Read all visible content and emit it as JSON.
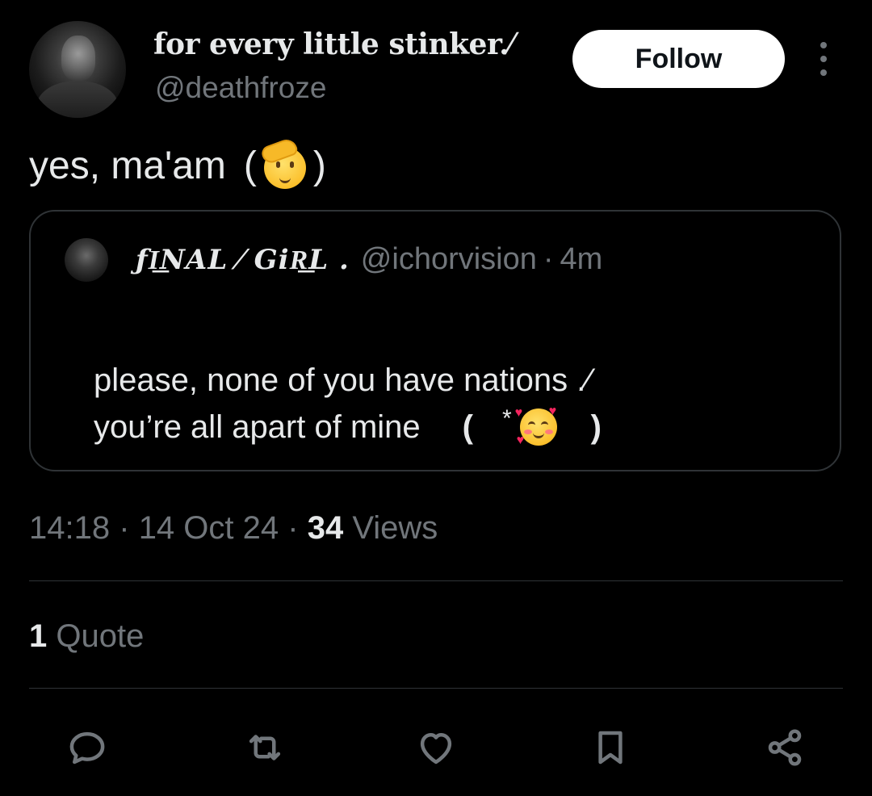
{
  "header": {
    "display_name": "for every little stinker.⁄",
    "handle": "@deathfroze",
    "follow_label": "Follow"
  },
  "tweet": {
    "text": "yes, ma'am",
    "paren_open": "(",
    "paren_close": ")",
    "emoji": "saluting-face"
  },
  "quoted": {
    "display_name": "ƒI͟NAL ⁄  GiR͟L .",
    "handle": "@ichorvision",
    "separator": "·",
    "time": "4m",
    "line1": "please, none of you have nations .⁄",
    "line2": "you’re all apart of mine",
    "paren_open": "(",
    "star": "*",
    "paren_close": ")",
    "emoji": "smiling-face-with-hearts"
  },
  "meta": {
    "time": "14:18",
    "sep1": "·",
    "date": "14 Oct 24",
    "sep2": "·",
    "views_count": "34",
    "views_label": "Views"
  },
  "stats": {
    "quote_count": "1",
    "quote_label": "Quote"
  },
  "actions": [
    "reply-icon",
    "retweet-icon",
    "like-icon",
    "bookmark-icon",
    "share-icon"
  ],
  "colors": {
    "background": "#000000",
    "primary_text": "#e7e9ea",
    "secondary_text": "#71767b",
    "border": "#2f3336",
    "follow_button_bg": "#ffffff"
  }
}
